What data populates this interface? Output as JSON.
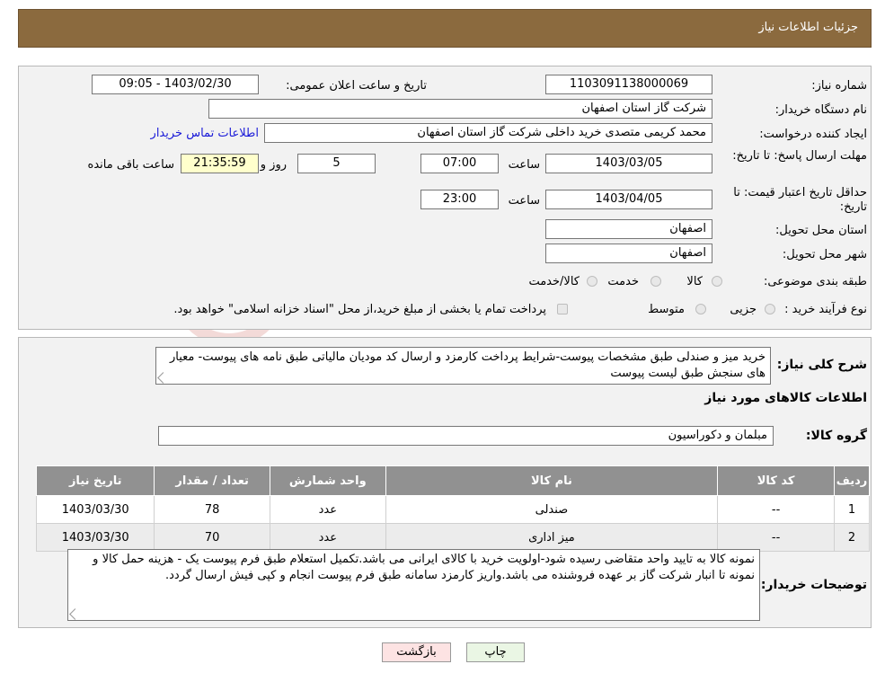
{
  "header": {
    "title": "جزئیات اطلاعات نیاز"
  },
  "labels": {
    "need_number": "شماره نیاز:",
    "announce_datetime": "تاریخ و ساعت اعلان عمومی:",
    "buyer_org": "نام دستگاه خریدار:",
    "requester": "ایجاد کننده درخواست:",
    "contact_link": "اطلاعات تماس خریدار",
    "reply_deadline": "مهلت ارسال پاسخ: تا تاریخ:",
    "time": "ساعت",
    "day_and": "روز و",
    "remaining": "ساعت باقی مانده",
    "price_validity": "حداقل تاریخ اعتبار قیمت: تا تاریخ:",
    "delivery_province": "استان محل تحویل:",
    "delivery_city": "شهر محل تحویل:",
    "category": "طبقه بندی موضوعی:",
    "process_type": "نوع فرآیند خرید :",
    "summary": "شرح کلی نیاز:",
    "goods_info": "اطلاعات کالاهای مورد نیاز",
    "goods_group": "گروه کالا:",
    "buyer_notes": "توضیحات خریدار:"
  },
  "values": {
    "need_number": "1103091138000069",
    "announce_datetime": "1403/02/30 - 09:05",
    "buyer_org": "شرکت گاز استان اصفهان",
    "requester": "محمد کریمی متصدی خرید داخلی شرکت گاز استان اصفهان",
    "reply_date": "1403/03/05",
    "reply_time": "07:00",
    "days_remaining": "5",
    "time_remaining": "21:35:59",
    "validity_date": "1403/04/05",
    "validity_time": "23:00",
    "delivery_province": "اصفهان",
    "delivery_city": "اصفهان",
    "category_options": [
      "کالا",
      "خدمت",
      "کالا/خدمت"
    ],
    "process_options": [
      "جزیی",
      "متوسط"
    ],
    "process_note": "پرداخت تمام یا بخشی از مبلغ خرید،از محل \"اسناد خزانه اسلامی\" خواهد بود.",
    "summary": "خرید میز و صندلی طبق مشخصات پیوست-شرایط پرداخت کارمزد و ارسال کد مودیان مالیاتی طبق نامه های پیوست- معیار های سنجش طبق لیست پیوست",
    "goods_group": "مبلمان و دکوراسیون",
    "buyer_notes": "نمونه کالا به تایید واحد متقاضی رسیده شود-اولویت خرید با کالای ایرانی می باشد.تکمیل استعلام طبق فرم پیوست یک - هزینه حمل کالا و نمونه تا انبار شرکت گاز بر عهده فروشنده می باشد.واریز کارمزد سامانه طبق فرم پیوست انجام و کپی فیش ارسال گردد."
  },
  "table": {
    "headers": [
      "ردیف",
      "کد کالا",
      "نام کالا",
      "واحد شمارش",
      "تعداد / مقدار",
      "تاریخ نیاز"
    ],
    "rows": [
      [
        "1",
        "--",
        "صندلی",
        "عدد",
        "78",
        "1403/03/30"
      ],
      [
        "2",
        "--",
        "میز اداری",
        "عدد",
        "70",
        "1403/03/30"
      ]
    ]
  },
  "buttons": {
    "print": "چاپ",
    "back": "بازگشت"
  },
  "colors": {
    "header_bg": "#8b6a3e",
    "table_header_bg": "#919191",
    "remaining_bg": "#ffffcc",
    "link": "#1a1ad8",
    "back_btn_bg": "#fde3e3",
    "print_btn_bg": "#eaf6e4"
  }
}
